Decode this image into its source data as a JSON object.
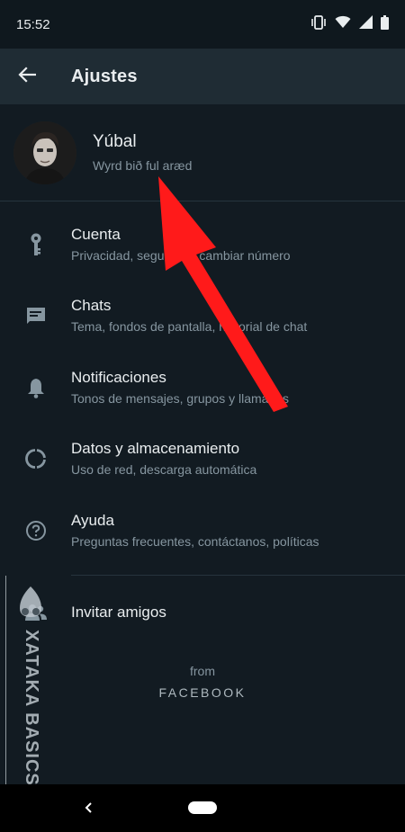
{
  "status_bar": {
    "time": "15:52",
    "icons": [
      "vibrate-icon",
      "wifi-icon",
      "signal-icon",
      "battery-icon"
    ]
  },
  "header": {
    "title": "Ajustes",
    "back_icon": "arrow-back-icon"
  },
  "profile": {
    "name": "Yúbal",
    "status": "Wyrd bið ful aræd"
  },
  "menu": [
    {
      "icon": "key-icon",
      "title": "Cuenta",
      "subtitle": "Privacidad, seguridad, cambiar número"
    },
    {
      "icon": "chat-icon",
      "title": "Chats",
      "subtitle": "Tema, fondos de pantalla, historial de chat"
    },
    {
      "icon": "bell-icon",
      "title": "Notificaciones",
      "subtitle": "Tonos de mensajes, grupos y llamadas"
    },
    {
      "icon": "data-usage-icon",
      "title": "Datos y almacenamiento",
      "subtitle": "Uso de red, descarga automática"
    },
    {
      "icon": "help-icon",
      "title": "Ayuda",
      "subtitle": "Preguntas frecuentes, contáctanos, políticas"
    }
  ],
  "invite": {
    "icon": "people-icon",
    "label": "Invitar amigos"
  },
  "footer": {
    "from": "from",
    "brand": "FACEBOOK"
  },
  "watermark": {
    "text": "XATAKA BASICS"
  },
  "annotation": {
    "arrow_color": "#ff1a1a"
  },
  "colors": {
    "background": "#121b22",
    "app_bar": "#1f2c34",
    "primary_text": "#e9edef",
    "secondary_text": "#8696a0",
    "icon": "#8696a0"
  }
}
